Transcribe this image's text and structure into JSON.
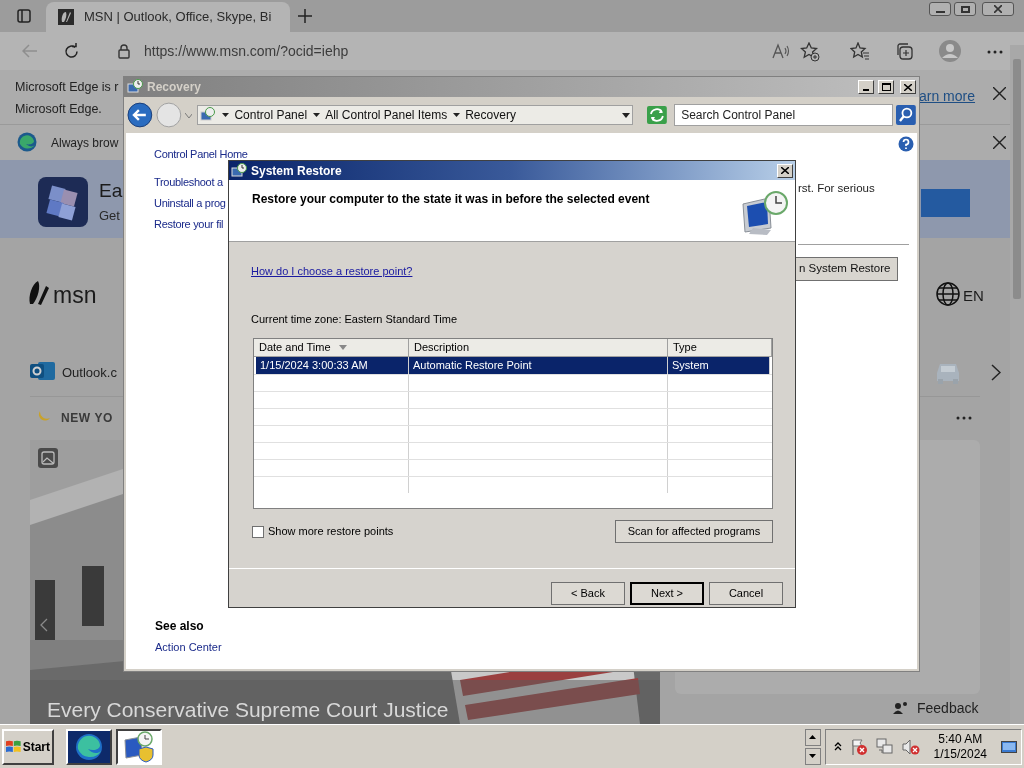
{
  "browser": {
    "tab": {
      "title": "MSN | Outlook, Office, Skype, Bi",
      "selected": true
    },
    "address": "https://www.msn.com/?ocid=iehp",
    "infobar": {
      "lines": [
        "Microsoft Edge is r",
        "Microsoft Edge."
      ],
      "link": "arn more"
    },
    "notice": {
      "text": "Always brow"
    },
    "page": {
      "promo": {
        "title": "Ea",
        "subtitle": "Get"
      },
      "logo": "msn",
      "language": "EN",
      "quick_link": "Outlook.c",
      "weather": "NEW YO",
      "headline": "Every Conservative Supreme Court Justice",
      "feedback": "Feedback"
    }
  },
  "recovery_window": {
    "title": "Recovery",
    "breadcrumb": [
      "Control Panel",
      "All Control Panel Items",
      "Recovery"
    ],
    "search": {
      "placeholder": "Search Control Panel"
    },
    "links": [
      "Control Panel Home",
      "Troubleshoot a",
      "Uninstall a prog",
      "Restore your fil"
    ],
    "body_text": "rst. For serious",
    "button": "n System Restore",
    "see_also": {
      "heading": "See also",
      "links": [
        "Action Center"
      ]
    }
  },
  "dialog": {
    "title": "System Restore",
    "heading": "Restore your computer to the state it was in before the selected event",
    "help_link": "How do I choose a restore point?",
    "time_zone": "Current time zone: Eastern Standard Time",
    "table": {
      "columns": [
        {
          "label": "Date and Time",
          "sorted": true
        },
        {
          "label": "Description",
          "sorted": false
        },
        {
          "label": "Type",
          "sorted": false
        }
      ],
      "rows": [
        {
          "cells": [
            "1/15/2024 3:00:33 AM",
            "Automatic Restore Point",
            "System"
          ],
          "selected": true
        }
      ]
    },
    "show_more": {
      "label": "Show more restore points",
      "checked": false
    },
    "scan_button": "Scan for affected programs",
    "buttons": [
      {
        "label": "< Back",
        "default": false
      },
      {
        "label": "Next >",
        "default": true
      },
      {
        "label": "Cancel",
        "default": false
      }
    ]
  },
  "taskbar": {
    "start": "Start",
    "apps": [
      {
        "kind": "browser",
        "selected": false
      },
      {
        "kind": "restore",
        "selected": true
      }
    ],
    "clock": {
      "time": "5:40 AM",
      "date": "1/15/2024"
    }
  }
}
